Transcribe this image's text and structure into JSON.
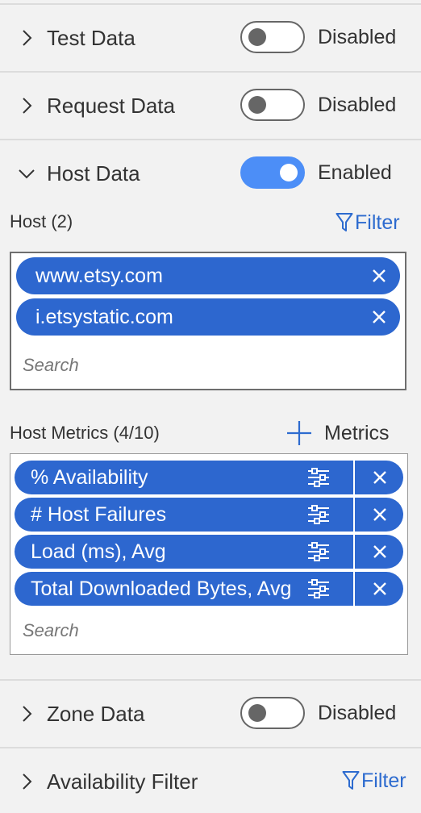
{
  "sections": {
    "test_data": {
      "label": "Test Data",
      "toggle_state": "Disabled"
    },
    "request_data": {
      "label": "Request Data",
      "toggle_state": "Disabled"
    },
    "host_data": {
      "label": "Host Data",
      "toggle_state": "Enabled",
      "host_label": "Host (2)",
      "filter_label": "Filter",
      "hosts": [
        {
          "label": "www.etsy.com"
        },
        {
          "label": "i.etsystatic.com"
        }
      ],
      "host_search_placeholder": "Search",
      "metrics_label": "Host Metrics (4/10)",
      "add_metrics_label": "Metrics",
      "metrics": [
        {
          "label": "% Availability"
        },
        {
          "label": "# Host Failures"
        },
        {
          "label": "Load (ms), Avg"
        },
        {
          "label": "Total Downloaded Bytes, Avg"
        }
      ],
      "metrics_search_placeholder": "Search"
    },
    "zone_data": {
      "label": "Zone Data",
      "toggle_state": "Disabled"
    },
    "availability_filter": {
      "label": "Availability Filter",
      "filter_label": "Filter"
    }
  },
  "colors": {
    "accent": "#2d67cf",
    "toggle_on": "#4c8ef7",
    "link": "#2d6bcf"
  },
  "icons": {
    "chevron_collapsed": "chevron-right-icon",
    "chevron_expanded": "chevron-down-icon",
    "filter": "funnel-icon",
    "remove": "close-icon",
    "settings": "sliders-icon",
    "add": "plus-icon"
  }
}
